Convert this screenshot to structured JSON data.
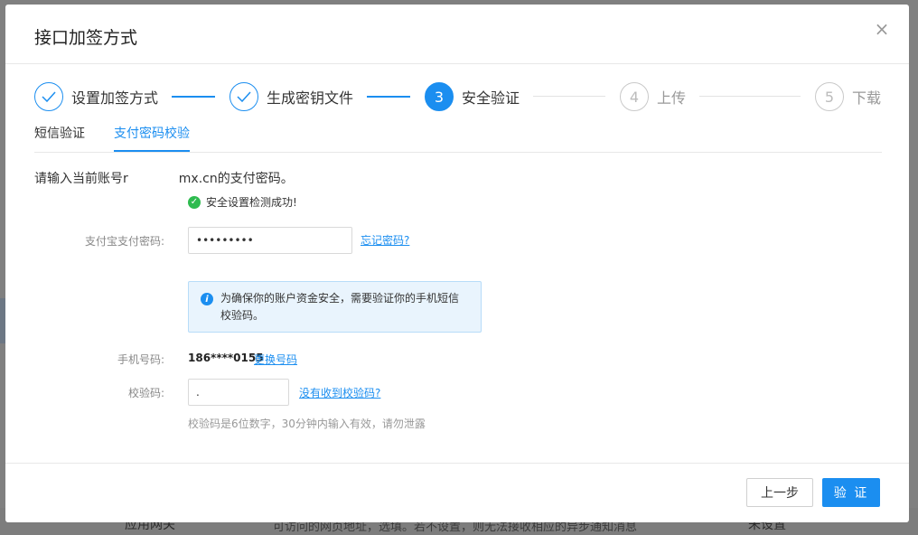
{
  "modal": {
    "title": "接口加签方式",
    "close_glyph": "×"
  },
  "steps": [
    {
      "label": "设置加签方式",
      "state": "done"
    },
    {
      "label": "生成密钥文件",
      "state": "done"
    },
    {
      "number": "3",
      "label": "安全验证",
      "state": "active"
    },
    {
      "number": "4",
      "label": "上传",
      "state": "pending"
    },
    {
      "number": "5",
      "label": "下载",
      "state": "pending"
    }
  ],
  "tabs": [
    {
      "label": "短信验证",
      "active": false
    },
    {
      "label": "支付密码校验",
      "active": true
    }
  ],
  "account": {
    "prefix": "请输入当前账号r",
    "suffix": "mx.cn的支付密码。"
  },
  "success_message": "安全设置检测成功!",
  "password": {
    "label": "支付宝支付密码:",
    "value": "•••••••••",
    "forgot_link": "忘记密码?"
  },
  "info_notice": {
    "line1": "为确保你的账户资金安全，需要验证你的手机短信",
    "line2": "校验码。"
  },
  "phone": {
    "label": "手机号码:",
    "value": "186****0155",
    "change_link": "更换号码"
  },
  "code": {
    "label": "校验码:",
    "value": ".",
    "not_received_link": "没有收到校验码?",
    "hint": "校验码是6位数字，30分钟内输入有效，请勿泄露"
  },
  "footer": {
    "prev_label": "上一步",
    "verify_label": "验 证"
  },
  "background": {
    "left_text": "应用网关",
    "middle_text": "可访问的网页地址，选填。若不设置，则无法接收相应的异步通知消息",
    "right_text": "未设置"
  },
  "colors": {
    "accent": "#1b8ef0",
    "success": "#2ebb4f",
    "info_bg": "#e9f4fd"
  }
}
